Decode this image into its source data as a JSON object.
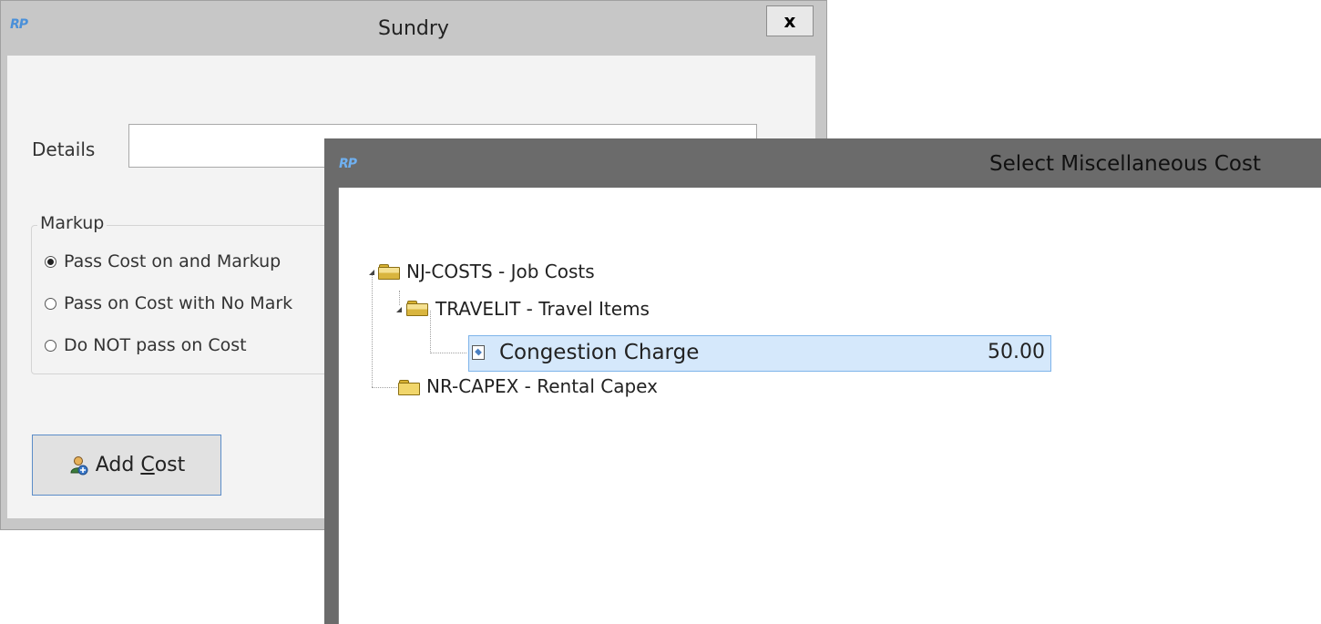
{
  "sundry": {
    "title": "Sundry",
    "logo": "RP",
    "close_label": "x",
    "details_label": "Details",
    "details_value": "",
    "markup": {
      "legend": "Markup",
      "options": [
        {
          "label": "Pass Cost on and Markup",
          "selected": true
        },
        {
          "label": "Pass on Cost with No Mark",
          "selected": false
        },
        {
          "label": "Do NOT pass on Cost",
          "selected": false
        }
      ]
    },
    "add_cost_button": {
      "prefix": "Add ",
      "accel": "C",
      "suffix": "ost",
      "icon": "add-cost-icon"
    }
  },
  "misc": {
    "title": "Select Miscellaneous Cost",
    "logo": "RP",
    "tree": {
      "root1": {
        "label": "NJ-COSTS - Job Costs",
        "expanded": true
      },
      "child1": {
        "label": "TRAVELIT - Travel Items",
        "expanded": true
      },
      "leaf": {
        "label": "Congestion Charge",
        "value": "50.00",
        "selected": true
      },
      "root2": {
        "label": "NR-CAPEX - Rental Capex",
        "expanded": false
      }
    }
  }
}
